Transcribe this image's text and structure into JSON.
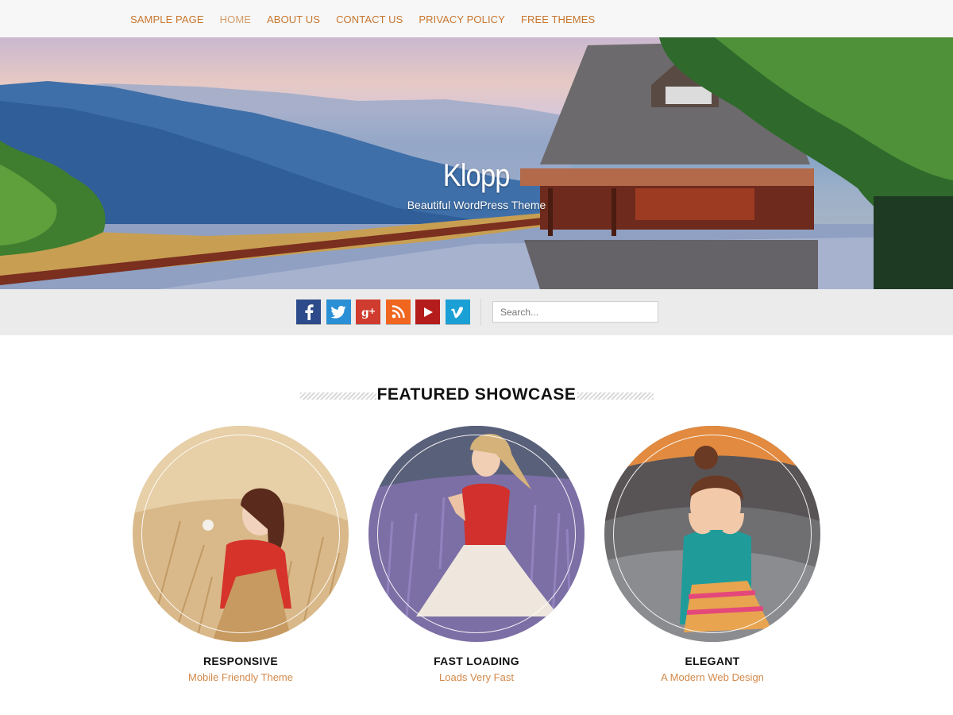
{
  "nav": {
    "items": [
      {
        "label": "SAMPLE PAGE",
        "active": false
      },
      {
        "label": "HOME",
        "active": true
      },
      {
        "label": "ABOUT US",
        "active": false
      },
      {
        "label": "CONTACT US",
        "active": false
      },
      {
        "label": "PRIVACY POLICY",
        "active": false
      },
      {
        "label": "FREE THEMES",
        "active": false
      }
    ]
  },
  "hero": {
    "title": "Klopp",
    "subtitle": "Beautiful WordPress Theme"
  },
  "social": {
    "buttons": [
      {
        "icon": "facebook-icon",
        "glyph": "f",
        "color": "#2d4a8a"
      },
      {
        "icon": "twitter-icon",
        "glyph": "t",
        "color": "#2a8fd4"
      },
      {
        "icon": "google-plus-icon",
        "glyph": "g+",
        "color": "#cf3b2e"
      },
      {
        "icon": "rss-icon",
        "glyph": "rss",
        "color": "#f0661f"
      },
      {
        "icon": "youtube-icon",
        "glyph": "play",
        "color": "#b51c1c"
      },
      {
        "icon": "vimeo-icon",
        "glyph": "v",
        "color": "#1ba0d6"
      }
    ],
    "search_placeholder": "Search..."
  },
  "featured": {
    "heading": "FEATURED SHOWCASE",
    "cards": [
      {
        "title": "RESPONSIVE",
        "subtitle": "Mobile Friendly Theme"
      },
      {
        "title": "FAST LOADING",
        "subtitle": "Loads Very Fast"
      },
      {
        "title": "ELEGANT",
        "subtitle": "A Modern Web Design"
      }
    ]
  },
  "colors": {
    "accent": "#c8762e",
    "nav_bg": "#f7f7f7",
    "social_bar_bg": "#ebebeb"
  }
}
